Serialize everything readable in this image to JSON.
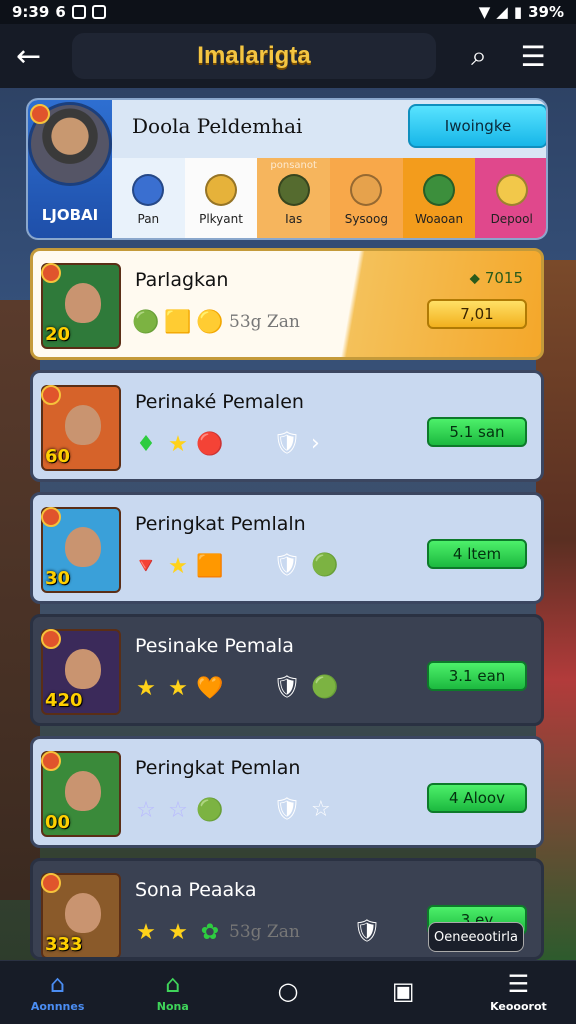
{
  "status": {
    "time": "9:39",
    "left_extra": "6",
    "battery": "39%"
  },
  "appbar": {
    "title": "Imalarigta"
  },
  "profile": {
    "name": "Doola Peldemhai",
    "avatar_label": "LJOBAI",
    "button_label": "Iwoingke",
    "tabs": [
      {
        "label": "Pan",
        "overlay": "",
        "bg": "#e9f2fb",
        "face": "#3a6fd0"
      },
      {
        "label": "Plkyant",
        "overlay": "",
        "bg": "#fbfbfb",
        "face": "#e6b23a"
      },
      {
        "label": "Ias",
        "overlay": "ponsanot",
        "bg": "#f6b55d",
        "face": "#556b2f"
      },
      {
        "label": "Sysoog",
        "overlay": "",
        "bg": "#f8a84a",
        "face": "#e6a24c"
      },
      {
        "label": "Woaoan",
        "overlay": "",
        "bg": "#f39c1c",
        "face": "#3c8f3c"
      },
      {
        "label": "Depool",
        "overlay": "",
        "bg": "#e0488c",
        "face": "#f2c84a"
      }
    ]
  },
  "cards": [
    {
      "title": "Parlagkan",
      "number": "20",
      "top_value": "⬥ 7015",
      "button": "7,01",
      "button_style": "yellow",
      "bg": "linear-gradient(100deg,#fffaf0 0%,#fffaf0 62%,#f4c15a 63%,#f4a72a 100%)",
      "border": "#c49a3a",
      "thumb": "#2f7a3a",
      "icons": [
        "🟢",
        "🟨",
        "🟡"
      ],
      "sub": "53g Zan",
      "extra": []
    },
    {
      "title": "Perinaké Pemalen",
      "number": "60",
      "top_value": "",
      "button": "5.1 san",
      "button_style": "green",
      "bg": "#c9d9f0",
      "border": "#3b4660",
      "thumb": "#d6632a",
      "icons": [
        "♦",
        "★",
        "🔴"
      ],
      "sub": "",
      "extra": [
        "🛡",
        "›"
      ]
    },
    {
      "title": "Peringkat Pemlaln",
      "number": "30",
      "top_value": "",
      "button": "4 ltem",
      "button_style": "green",
      "bg": "#c9d9f0",
      "border": "#3b4660",
      "thumb": "#3aa0d9",
      "icons": [
        "🔻",
        "★",
        "🟧"
      ],
      "sub": "",
      "extra": [
        "🛡",
        "🟢"
      ]
    },
    {
      "title": "Pesinake Pemala",
      "number": "420",
      "top_value": "",
      "button": "3.1 ean",
      "button_style": "green",
      "bg": "#3a4152",
      "border": "#2a3142",
      "thumb": "#3b2a5a",
      "icons": [
        "★",
        "★",
        "🧡"
      ],
      "sub": "",
      "extra": [
        "🛡",
        "🟢"
      ]
    },
    {
      "title": "Peringkat Pemlan",
      "number": "00",
      "top_value": "",
      "button": "4 Aloov",
      "button_style": "green",
      "bg": "#c9d9f0",
      "border": "#3b4660",
      "thumb": "#3a8a3a",
      "icons": [
        "☆",
        "☆",
        "🟢"
      ],
      "sub": "",
      "extra": [
        "🛡",
        "☆"
      ]
    },
    {
      "title": "Sona Peaaka",
      "number": "333",
      "top_value": "",
      "button": "3 ey",
      "button_style": "green",
      "bg": "#3a4152",
      "border": "#2a3142",
      "thumb": "#8a5a2a",
      "icons": [
        "★",
        "★",
        "✿"
      ],
      "sub": "53g Zan",
      "extra": [
        "🛡"
      ]
    }
  ],
  "toast": "Oeneeootirla",
  "nav": [
    {
      "label": "Aonnnes",
      "glyph": "⌂",
      "color": "#4b8df2"
    },
    {
      "label": "Nona",
      "glyph": "⌂",
      "color": "#3fd45a"
    },
    {
      "label": "",
      "glyph": "○",
      "color": "#ffffff"
    },
    {
      "label": "",
      "glyph": "▣",
      "color": "#ffffff"
    },
    {
      "label": "Keooorot",
      "glyph": "☰",
      "color": "#ffffff"
    }
  ]
}
